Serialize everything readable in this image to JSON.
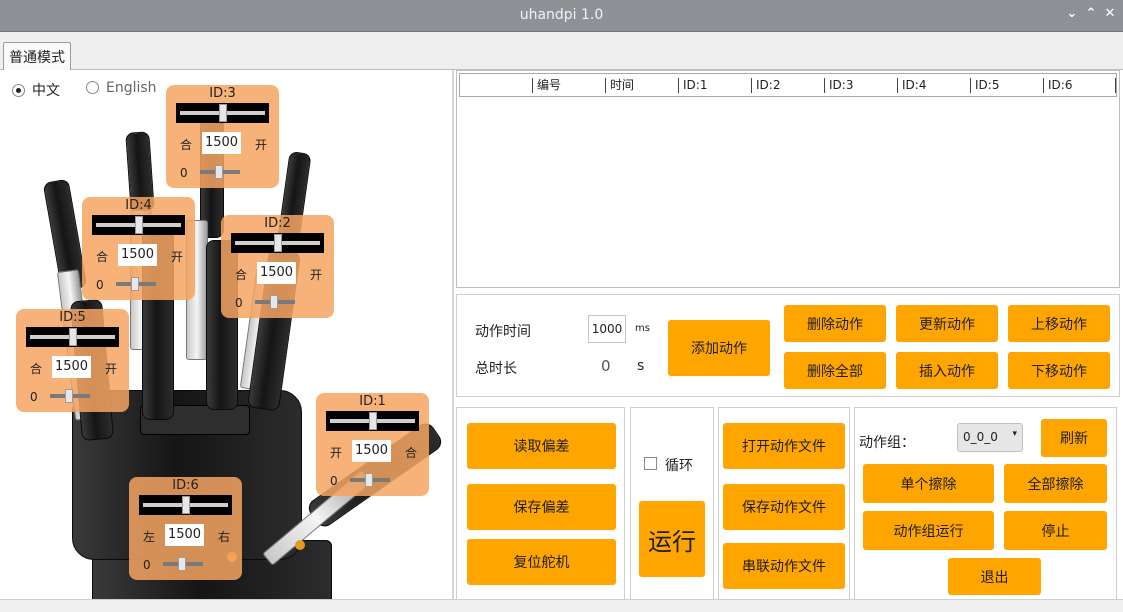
{
  "window": {
    "title": "uhandpi 1.0",
    "controls": [
      "⌄",
      "⌃",
      "✕"
    ]
  },
  "tabs": [
    {
      "label": "普通模式"
    }
  ],
  "language": {
    "options": [
      {
        "label": "中文",
        "selected": true
      },
      {
        "label": "English",
        "selected": false
      }
    ]
  },
  "servos": [
    {
      "id": "ID:3",
      "left_label": "合",
      "value": "1500",
      "right_label": "开",
      "offset": "0"
    },
    {
      "id": "ID:4",
      "left_label": "合",
      "value": "1500",
      "right_label": "开",
      "offset": "0"
    },
    {
      "id": "ID:2",
      "left_label": "合",
      "value": "1500",
      "right_label": "开",
      "offset": "0"
    },
    {
      "id": "ID:5",
      "left_label": "合",
      "value": "1500",
      "right_label": "开",
      "offset": "0"
    },
    {
      "id": "ID:1",
      "left_label": "开",
      "value": "1500",
      "right_label": "合",
      "offset": "0"
    },
    {
      "id": "ID:6",
      "left_label": "左",
      "value": "1500",
      "right_label": "右",
      "offset": "0"
    }
  ],
  "table": {
    "columns": [
      "编号",
      "时间",
      "ID:1",
      "ID:2",
      "ID:3",
      "ID:4",
      "ID:5",
      "ID:6"
    ],
    "rows": []
  },
  "action": {
    "time_label": "动作时间",
    "time_value": "1000",
    "time_unit": "ms",
    "total_label": "总时长",
    "total_value": "0",
    "total_unit": "s",
    "add_label": "添加动作",
    "delete_label": "删除动作",
    "update_label": "更新动作",
    "up_label": "上移动作",
    "delete_all_label": "删除全部",
    "insert_label": "插入动作",
    "down_label": "下移动作"
  },
  "deviation": {
    "read_label": "读取偏差",
    "save_label": "保存偏差",
    "reset_label": "复位舵机"
  },
  "run": {
    "loop_label": "循环",
    "run_label": "运行"
  },
  "files": {
    "open_label": "打开动作文件",
    "save_label": "保存动作文件",
    "chain_label": "串联动作文件"
  },
  "group": {
    "label": "动作组：",
    "selected": "0_0_0",
    "refresh_label": "刷新",
    "erase_one_label": "单个擦除",
    "erase_all_label": "全部擦除",
    "run_label": "动作组运行",
    "stop_label": "停止",
    "exit_label": "退出"
  },
  "colors": {
    "accent": "#ffa500",
    "servo_panel": "#f4a460",
    "titlebar": "#8e9297"
  }
}
